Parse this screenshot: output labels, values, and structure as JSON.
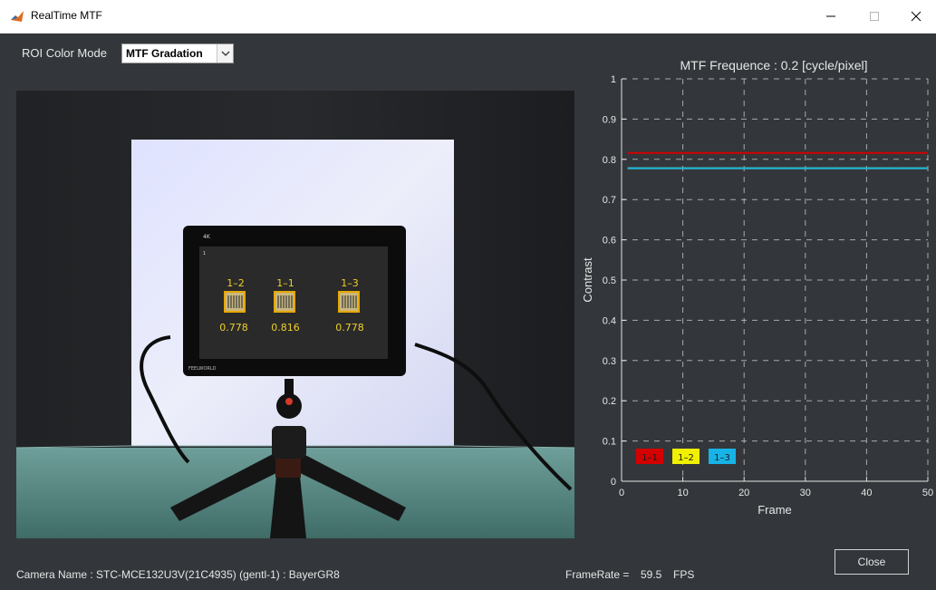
{
  "window": {
    "title": "RealTime MTF",
    "controls": {
      "minimize": "—",
      "maximize": "□",
      "close": "✕"
    }
  },
  "roi": {
    "label": "ROI Color Mode",
    "selected": "MTF Gradation"
  },
  "camera_view": {
    "monitor_badge": "4K",
    "monitor_brand": "FEELWORLD",
    "rois": [
      {
        "label": "1–2",
        "value": "0.778"
      },
      {
        "label": "1–1",
        "value": "0.816"
      },
      {
        "label": "1–3",
        "value": "0.778"
      }
    ]
  },
  "chart_data": {
    "type": "line",
    "title": "MTF Frequence : 0.2 [cycle/pixel]",
    "xlabel": "Frame",
    "ylabel": "Contrast",
    "xlim": [
      0,
      50
    ],
    "ylim": [
      0,
      1
    ],
    "xticks": [
      "0",
      "10",
      "20",
      "30",
      "40",
      "50"
    ],
    "yticks": [
      "0",
      "0.1",
      "0.2",
      "0.3",
      "0.4",
      "0.5",
      "0.6",
      "0.7",
      "0.8",
      "0.9",
      "1"
    ],
    "grid": true,
    "legend_position": "bottom-left",
    "x": [
      1,
      50
    ],
    "series": [
      {
        "name": "1–1",
        "color": "#d40000",
        "values": [
          0.816,
          0.816
        ]
      },
      {
        "name": "1–2",
        "color": "#f0f000",
        "values": [
          0.778,
          0.778
        ]
      },
      {
        "name": "1–3",
        "color": "#17b3e6",
        "values": [
          0.778,
          0.778
        ]
      }
    ]
  },
  "footer": {
    "camera_name": "Camera Name :  STC-MCE132U3V(21C4935) (gentl-1) : BayerGR8",
    "framerate_label": "FrameRate =",
    "framerate_value": "59.5",
    "framerate_unit": "FPS",
    "close_label": "Close"
  }
}
